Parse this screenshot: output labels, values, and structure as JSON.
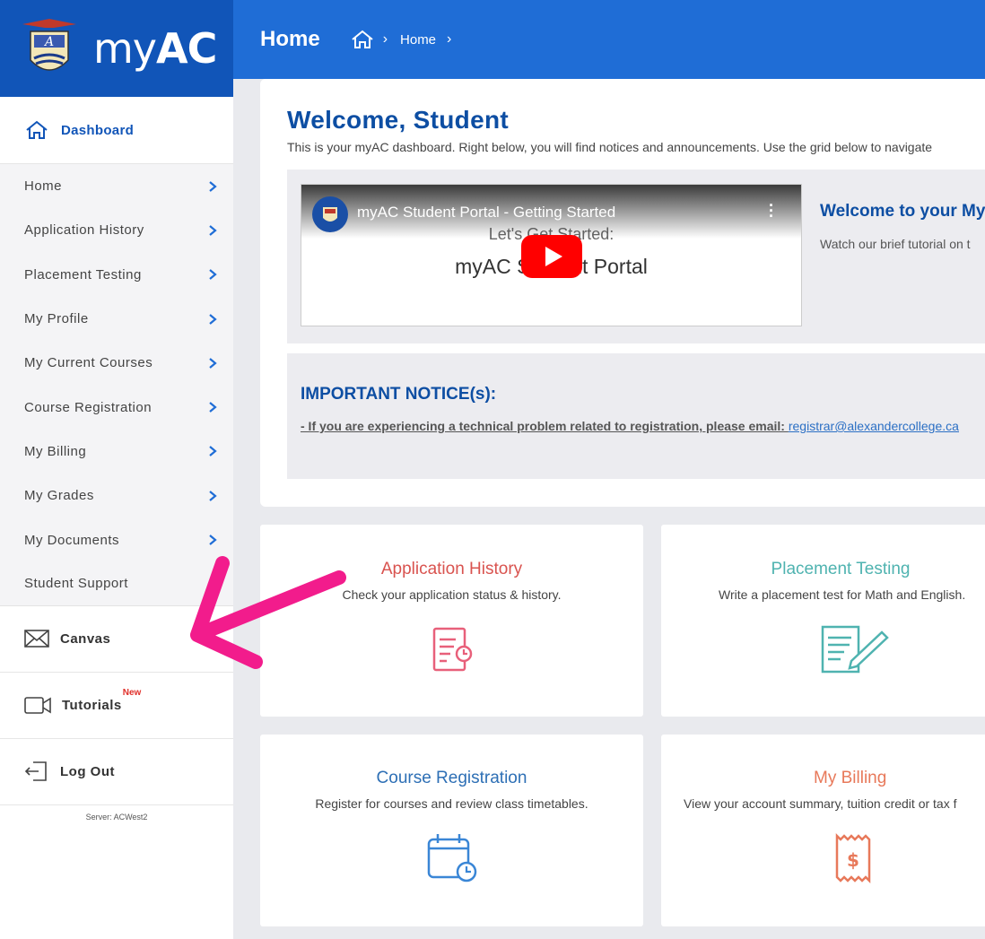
{
  "brand": {
    "name_light": "my",
    "name_bold": "AC"
  },
  "sidebar": {
    "dashboard": "Dashboard",
    "items": [
      {
        "label": "Home"
      },
      {
        "label": "Application History"
      },
      {
        "label": "Placement Testing"
      },
      {
        "label": "My Profile"
      },
      {
        "label": "My Current Courses"
      },
      {
        "label": "Course Registration"
      },
      {
        "label": "My Billing"
      },
      {
        "label": "My Grades"
      },
      {
        "label": "My Documents"
      }
    ],
    "support": "Student Support",
    "canvas": "Canvas",
    "tutorials": "Tutorials",
    "tutorials_badge": "New",
    "logout": "Log Out",
    "server": "Server: ACWest2"
  },
  "header": {
    "title": "Home",
    "breadcrumb": "Home"
  },
  "main": {
    "welcome": "Welcome, Student",
    "subtitle": "This is your myAC dashboard. Right below, you will find notices and announcements. Use the grid below to navigate",
    "video": {
      "title": "myAC Student Portal - Getting Started",
      "line1": "Let's Get Started:",
      "line2": "myAC Student Portal",
      "side_title": "Welcome to your MyA",
      "side_text": "Watch our brief tutorial on t"
    },
    "notice": {
      "title": "IMPORTANT NOTICE(s):",
      "text": "- If you are experiencing a technical problem related to registration, please email: ",
      "email": "registrar@alexandercollege.ca"
    },
    "cards": [
      {
        "title": "Application History",
        "desc": "Check your application status & history.",
        "color": "#d9534f",
        "icon": "document-clock-icon"
      },
      {
        "title": "Placement Testing",
        "desc": "Write a placement test for Math and English.",
        "color": "#4fb3b0",
        "icon": "pencil-paper-icon"
      },
      {
        "title": "Course Registration",
        "desc": "Register for courses and review class timetables.",
        "color": "#2d6fb5",
        "icon": "calendar-clock-icon"
      },
      {
        "title": "My Billing",
        "desc": "View your account summary, tuition credit or tax f",
        "color": "#e8795a",
        "icon": "receipt-dollar-icon"
      }
    ]
  },
  "colors": {
    "primary": "#1155b8",
    "topbar": "#1f6dd6",
    "annotation_arrow": "#f21c8c"
  }
}
